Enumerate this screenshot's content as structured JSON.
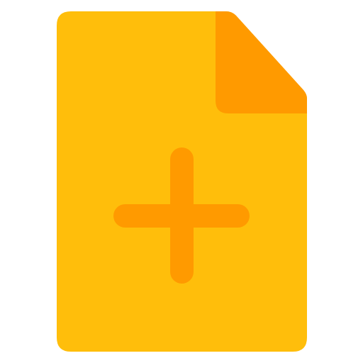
{
  "icon": {
    "name": "new-file-icon",
    "parts": {
      "document": "document-shape",
      "fold": "folded-corner",
      "plus": "plus-icon"
    }
  },
  "colors": {
    "background": "#ffffff",
    "document": "#ffbe0b",
    "accent": "#ff9a00"
  }
}
